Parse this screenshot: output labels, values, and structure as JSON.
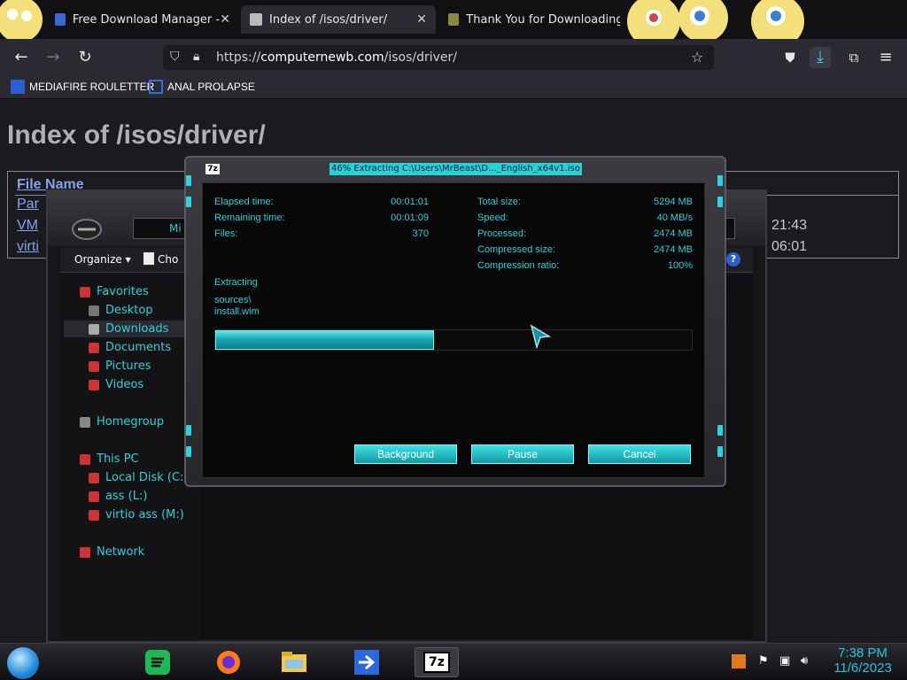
{
  "browser": {
    "tabs": [
      {
        "label": "Free Download Manager - dow",
        "close": "✕"
      },
      {
        "label": "Index of /isos/driver/",
        "close": "✕"
      },
      {
        "label": "Thank You for Downloading Ea",
        "close": "✕"
      }
    ],
    "url_prefix": "https://",
    "url_host": "computernewb.com",
    "url_path": "/isos/driver/",
    "bookmarks": [
      {
        "label": "MEDIAFIRE ROULETTER"
      },
      {
        "label": "ANAL PROLAPSE"
      }
    ]
  },
  "page": {
    "title": "Index of /isos/driver/",
    "header_file_name": "File Name",
    "rows": [
      {
        "name": "Par",
        "time": ""
      },
      {
        "name": "VM",
        "time": "21:43"
      },
      {
        "name": "virti",
        "time": "06:01"
      }
    ]
  },
  "explorer": {
    "address_short": "Mi",
    "organize": "Organize ▾",
    "choose": "Cho",
    "help": "?",
    "nav": [
      {
        "label": "Favorites"
      },
      {
        "label": "Desktop"
      },
      {
        "label": "Downloads"
      },
      {
        "label": "Documents"
      },
      {
        "label": "Pictures"
      },
      {
        "label": "Videos"
      },
      {
        "label": "Homegroup"
      },
      {
        "label": "This PC"
      },
      {
        "label": "Local Disk (C:)"
      },
      {
        "label": "ass (L:)"
      },
      {
        "label": "virtio ass (M:)"
      },
      {
        "label": "Network"
      }
    ]
  },
  "sevenzip": {
    "logo": "7z",
    "title": "46% Extracting C:\\Users\\MrBeast\\D..._English_x64v1.iso",
    "progress_fraction": 0.46,
    "left": [
      {
        "label": "Elapsed time:",
        "value": "00:01:01"
      },
      {
        "label": "Remaining time:",
        "value": "00:01:09"
      },
      {
        "label": "Files:",
        "value": "370"
      }
    ],
    "right": [
      {
        "label": "Total size:",
        "value": "5294 MB"
      },
      {
        "label": "Speed:",
        "value": "40 MB/s"
      },
      {
        "label": "Processed:",
        "value": "2474 MB"
      },
      {
        "label": "Compressed size:",
        "value": "2474 MB"
      },
      {
        "label": "Compression ratio:",
        "value": "100%"
      }
    ],
    "status": "Extracting",
    "path1": "sources\\",
    "path2": "install.wim",
    "buttons": {
      "background": "Background",
      "pause": "Pause",
      "cancel": "Cancel"
    }
  },
  "taskbar": {
    "time": "7:38 PM",
    "date": "11/6/2023",
    "active_app": "7z"
  },
  "colors": {
    "accent": "#2ed1dc",
    "link": "#7fa6ea"
  }
}
